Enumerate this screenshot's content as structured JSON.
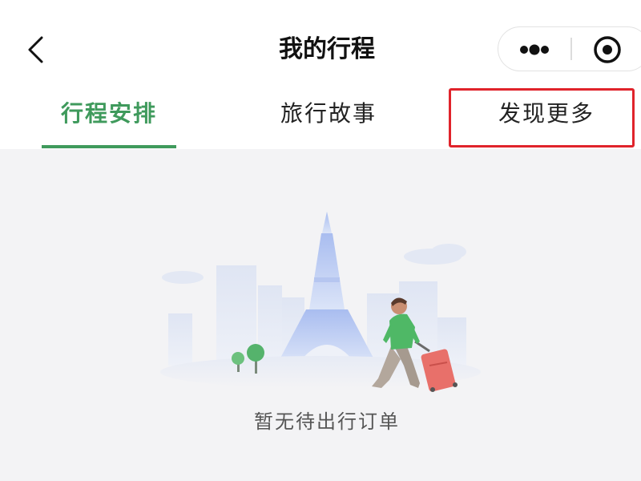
{
  "header": {
    "title": "我的行程",
    "back_icon": "chevron-left-icon",
    "more_icon": "more-dots-icon",
    "close_icon": "target-circle-icon"
  },
  "tabs": [
    {
      "label": "行程安排",
      "active": true
    },
    {
      "label": "旅行故事",
      "active": false
    },
    {
      "label": "发现更多",
      "active": false,
      "highlighted": true
    }
  ],
  "colors": {
    "accent_green": "#3f9a5c",
    "highlight_red": "#e0232b",
    "background": "#f3f3f5"
  },
  "empty_state": {
    "illustration": "traveler-eiffel-tower-illustration",
    "message": "暂无待出行订单"
  }
}
